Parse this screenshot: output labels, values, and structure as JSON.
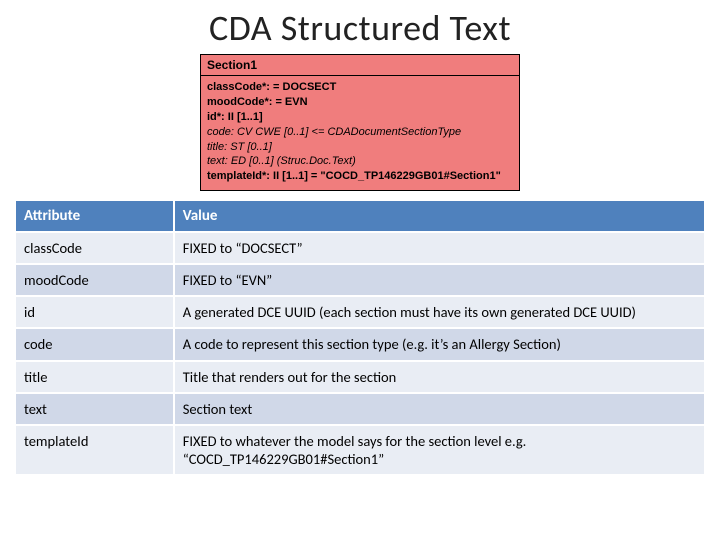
{
  "title": "CDA Structured Text",
  "diagram": {
    "heading": "Section1",
    "lines": [
      "classCode*: = DOCSECT",
      "moodCode*: = EVN",
      "id*: II [1..1]",
      "code: CV CWE [0..1] <= CDADocumentSectionType",
      "title: ST [0..1]",
      "text: ED [0..1] (Struc.Doc.Text)",
      "templateId*: II [1..1] = \"COCD_TP146229GB01#Section1\""
    ]
  },
  "table": {
    "headers": {
      "attr": "Attribute",
      "val": "Value"
    },
    "rows": [
      {
        "attr": "classCode",
        "val": "FIXED to “DOCSECT”"
      },
      {
        "attr": "moodCode",
        "val": "FIXED to “EVN”"
      },
      {
        "attr": "id",
        "val": "A generated DCE UUID (each section must have its own generated DCE UUID)"
      },
      {
        "attr": "code",
        "val": "A code to represent this section type (e.g. it’s an Allergy Section)"
      },
      {
        "attr": "title",
        "val": "Title that renders out for the section"
      },
      {
        "attr": "text",
        "val": "Section text"
      },
      {
        "attr": "templateId",
        "val": "FIXED to whatever the model says for the section level e.g. “COCD_TP146229GB01#Section1”"
      }
    ]
  },
  "chart_data": {
    "type": "table",
    "title": "CDA Structured Text",
    "columns": [
      "Attribute",
      "Value"
    ],
    "rows": [
      [
        "classCode",
        "FIXED to \"DOCSECT\""
      ],
      [
        "moodCode",
        "FIXED to \"EVN\""
      ],
      [
        "id",
        "A generated DCE UUID (each section must have its own generated DCE UUID)"
      ],
      [
        "code",
        "A code to represent this section type (e.g. it's an Allergy Section)"
      ],
      [
        "title",
        "Title that renders out for the section"
      ],
      [
        "text",
        "Section text"
      ],
      [
        "templateId",
        "FIXED to whatever the model says for the section level e.g. \"COCD_TP146229GB01#Section1\""
      ]
    ]
  }
}
